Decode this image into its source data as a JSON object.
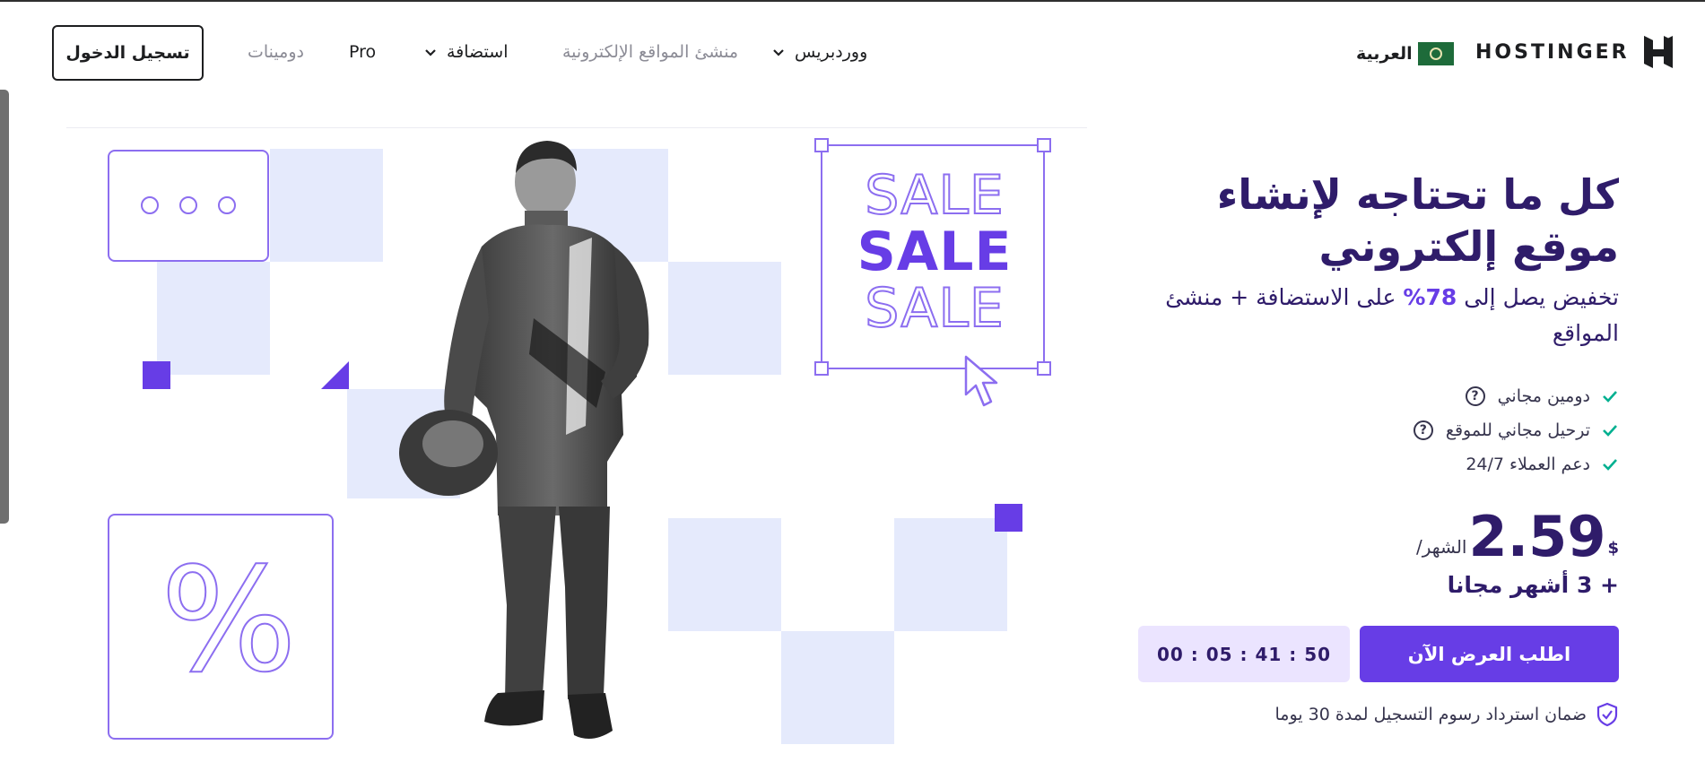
{
  "header": {
    "brand": "HOSTINGER",
    "language": "العربية",
    "nav": {
      "wordpress": "ووردبريس",
      "website_builder": "منشئ المواقع الإلكترونية",
      "hosting": "استضافة",
      "pro": "Pro",
      "domains": "دومينات"
    },
    "login": "تسجيل الدخول"
  },
  "hero": {
    "sale_words": [
      "SALE",
      "SALE",
      "SALE"
    ],
    "percent_symbol": "%",
    "title": "كل ما تحتاجه لإنشاء موقع إلكتروني",
    "subtitle_prefix": "تخفيض يصل إلى",
    "subtitle_percent": "78%",
    "subtitle_suffix": "على الاستضافة + منشئ المواقع",
    "features": [
      {
        "label": "دومين مجاني",
        "has_help": true
      },
      {
        "label": "ترحيل مجاني للموقع",
        "has_help": true
      },
      {
        "label": "دعم العملاء 24/7",
        "has_help": false
      }
    ],
    "price": {
      "currency": "$",
      "amount": "2.59",
      "period": "/الشهر"
    },
    "bonus": "+ 3 أشهر مجانا",
    "cta": "اطلب العرض الآن",
    "timer": "00 : 05 : 41 : 50",
    "guarantee": "ضمان استرداد رسوم التسجيل لمدة 30 يوما"
  },
  "colors": {
    "accent": "#673de6",
    "heading": "#2f1c6a",
    "light_square": "#e5eafc",
    "check": "#00b090"
  },
  "icons": [
    "hostinger-logo-icon",
    "flag-icon",
    "chevron-down-icon",
    "check-icon",
    "help-icon",
    "shield-check-icon",
    "cursor-icon"
  ]
}
